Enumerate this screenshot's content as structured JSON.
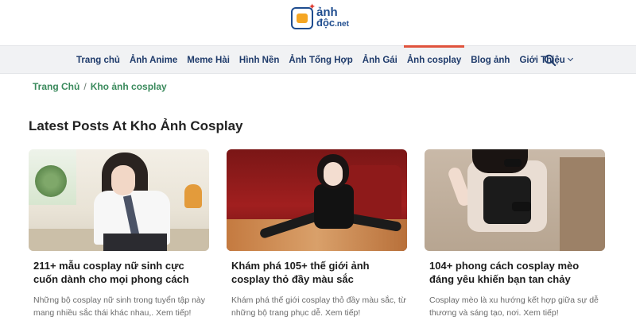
{
  "site": {
    "logo_line1": "ảnh",
    "logo_line2": "độc",
    "logo_tld": ".net",
    "brand_color": "#1f4d8f",
    "logo_accent_color": "#f5a623",
    "logo_spark_color": "#e03c31"
  },
  "nav": {
    "items": [
      {
        "label": "Trang chủ",
        "active": false
      },
      {
        "label": "Ảnh Anime",
        "active": false
      },
      {
        "label": "Meme Hài",
        "active": false
      },
      {
        "label": "Hình Nền",
        "active": false
      },
      {
        "label": "Ảnh Tổng Hợp",
        "active": false
      },
      {
        "label": "Ảnh Gái",
        "active": false
      },
      {
        "label": "Ảnh cosplay",
        "active": true
      },
      {
        "label": "Blog ảnh",
        "active": false
      },
      {
        "label": "Giới Thiệu",
        "active": false,
        "has_dropdown": true
      }
    ],
    "search_icon": "search-icon",
    "active_indicator_color": "#e0533d"
  },
  "breadcrumb": {
    "home": "Trang Chủ",
    "separator": "/",
    "current": "Kho ảnh cosplay",
    "color": "#3a8a5c"
  },
  "section": {
    "title": "Latest Posts At Kho Ảnh Cosplay"
  },
  "posts": [
    {
      "title": "211+ mẫu cosplay nữ sinh cực cuốn dành cho mọi phong cách",
      "excerpt": "Những bộ cosplay nữ sinh trong tuyển tập này mang nhiều sắc thái khác nhau,. Xem tiếp!"
    },
    {
      "title": "Khám phá 105+ thế giới ảnh cosplay thỏ đầy màu sắc",
      "excerpt": "Khám phá thế giới cosplay thỏ đầy màu sắc, từ những bộ trang phục dễ. Xem tiếp!"
    },
    {
      "title": "104+ phong cách cosplay mèo đáng yêu khiến bạn tan chảy",
      "excerpt": "Cosplay mèo là xu hướng kết hợp giữa sự dễ thương và sáng tạo, nơi. Xem tiếp!"
    }
  ]
}
